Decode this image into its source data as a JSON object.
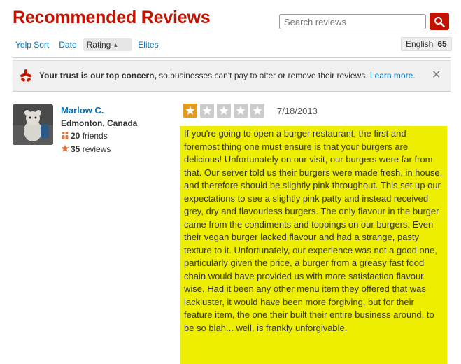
{
  "header": {
    "title": "Recommended Reviews",
    "search_placeholder": "Search reviews"
  },
  "sort": {
    "yelp": "Yelp Sort",
    "date": "Date",
    "rating": "Rating",
    "elites": "Elites"
  },
  "language": {
    "label": "English",
    "count": "65"
  },
  "trust": {
    "bold": "Your trust is our top concern,",
    "rest": " so businesses can't pay to alter or remove their reviews. ",
    "link": "Learn more."
  },
  "review": {
    "user": "Marlow C.",
    "location": "Edmonton, Canada",
    "friends_count": "20",
    "friends_label": "friends",
    "reviews_count": "35",
    "reviews_label": "reviews",
    "rating": 1,
    "date": "7/18/2013",
    "text": "If you're going to open a burger restaurant, the first and foremost thing one must ensure is that your burgers are delicious! Unfortunately on our visit, our burgers were far from that. Our server told us their burgers were made fresh, in house, and therefore should be slightly pink throughout. This set up our expectations to see a slightly pink patty and instead received grey, dry and flavourless burgers. The only flavour in the burger came from the condiments and toppings on our burgers. Even their vegan burger lacked flavour and had a strange, pasty texture to it. Unfortunately, our experience was not a good one, particularly given the price, a burger from a greasy fast food chain would have provided us with more satisfaction flavour wise. Had it been any other menu item they offered that was lackluster, it would have been more forgiving, but for their feature item, the one their built their entire business around, to be so blah... well, is frankly unforgivable."
  },
  "colors": {
    "brand": "#c41200",
    "link": "#0073bb",
    "highlight": "#eeee00",
    "star": "#e39b1f"
  }
}
